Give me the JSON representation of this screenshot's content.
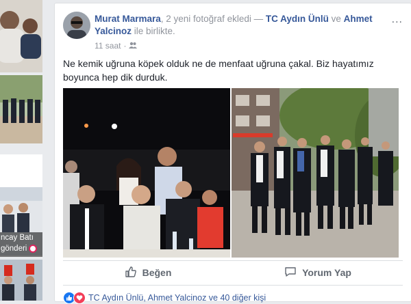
{
  "post": {
    "author": "Murat Marmara",
    "action_text": ", 2 yeni fotoğraf ekledi",
    "separator": " — ",
    "tagged_1": "TC Aydın Ünlü",
    "conj": " ve ",
    "tagged_2": "Ahmet Yalcinoz",
    "with_text": " ile birlikte.",
    "time": "11 saat",
    "more_icon": "...",
    "text": "Ne kemik uğruna köpek olduk ne de menfaat uğruna çakal. Biz hayatımız boyunca hep dik durduk."
  },
  "actions": {
    "like": "Beğen",
    "comment": "Yorum Yap"
  },
  "reactions": {
    "text": "TC Aydın Ünlü, Ahmet Yalcinoz ve 40 diğer kişi"
  },
  "sidebar": {
    "thumb_name": "ncay Batı",
    "thumb_action": "gönderi"
  },
  "colors": {
    "link": "#365899",
    "like_blue": "#1877f2",
    "love_red": "#f33e58"
  }
}
